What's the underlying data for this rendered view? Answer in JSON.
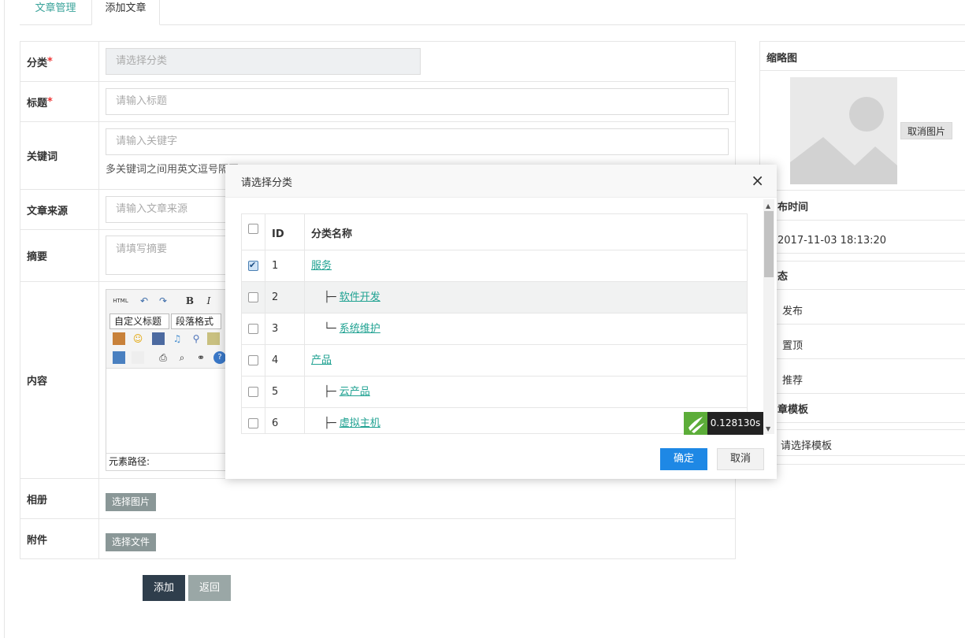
{
  "tabs": [
    "文章管理",
    "添加文章"
  ],
  "form": {
    "category_label": "分类",
    "category_placeholder": "请选择分类",
    "title_label": "标题",
    "title_placeholder": "请输入标题",
    "keywords_label": "关键词",
    "keywords_placeholder": "请输入关键字",
    "keywords_hint": "多关键词之间用英文逗号隔开",
    "source_label": "文章来源",
    "source_placeholder": "请输入文章来源",
    "summary_label": "摘要",
    "summary_placeholder": "请填写摘要",
    "content_label": "内容",
    "editor": {
      "html_label": "HTML",
      "bold": "B",
      "italic": "I",
      "custom_title": "自定义标题",
      "paragraph": "段落格式",
      "element_path": "元素路径:"
    },
    "album_label": "相册",
    "album_button": "选择图片",
    "attachment_label": "附件",
    "attachment_button": "选择文件",
    "required_mark": "*"
  },
  "actions": {
    "add": "添加",
    "back": "返回"
  },
  "side": {
    "thumbnail_label": "缩略图",
    "cancel_image": "取消图片",
    "publish_time_label": "布时间",
    "publish_time_value": "2017-11-03 18:13:20",
    "status_label": "态",
    "status_options": [
      "发布",
      "置顶",
      "推荐"
    ],
    "template_label": "章模板",
    "template_placeholder": "请选择模板"
  },
  "modal": {
    "title": "请选择分类",
    "close": "×",
    "columns": [
      "ID",
      "分类名称"
    ],
    "rows": [
      {
        "id": "1",
        "prefix": "",
        "name": "服务",
        "checked": true
      },
      {
        "id": "2",
        "prefix": "├─",
        "name": "软件开发",
        "checked": false
      },
      {
        "id": "3",
        "prefix": "└─",
        "name": "系统维护",
        "checked": false
      },
      {
        "id": "4",
        "prefix": "",
        "name": "产品",
        "checked": false
      },
      {
        "id": "5",
        "prefix": "├─",
        "name": "云产品",
        "checked": false
      },
      {
        "id": "6",
        "prefix": "├─",
        "name": "虚拟主机",
        "checked": false
      }
    ],
    "confirm": "确定",
    "cancel": "取消"
  },
  "timer": "0.128130s"
}
